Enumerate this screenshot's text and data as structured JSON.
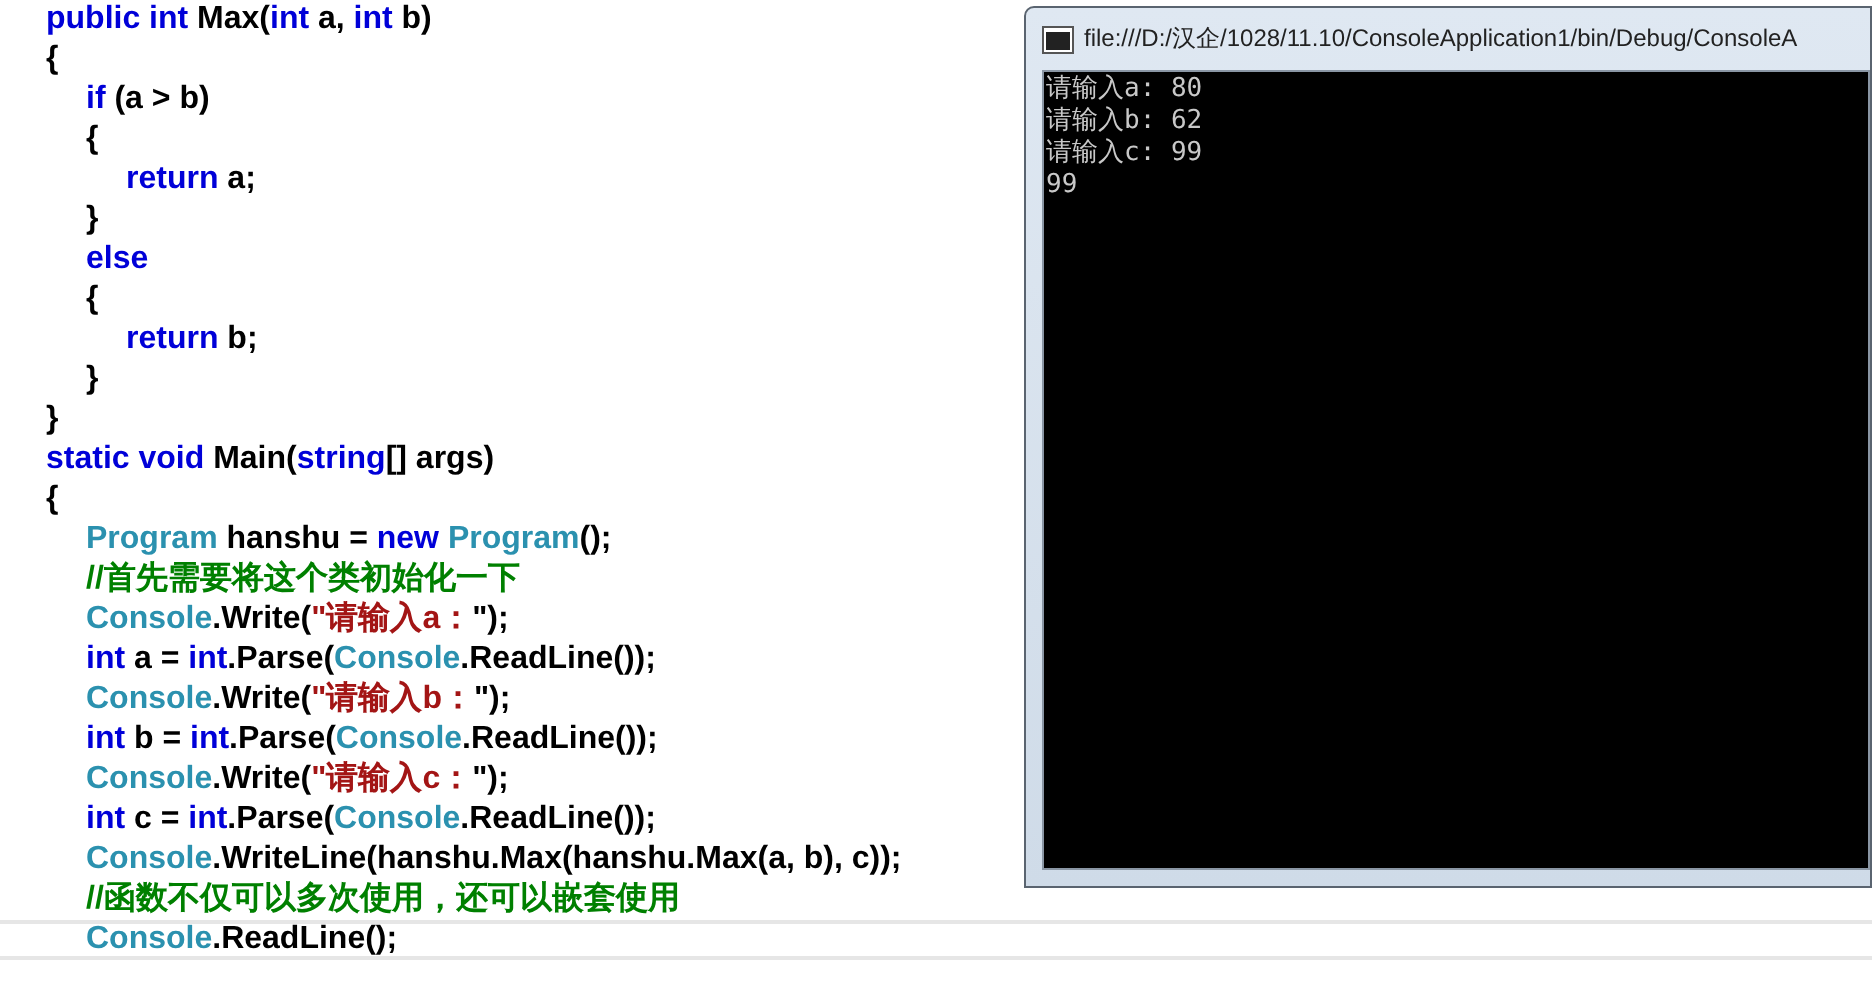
{
  "editor": {
    "lines": [
      {
        "current": false,
        "tokens": [
          {
            "kind": "keyword",
            "text": "public int "
          },
          {
            "kind": "plain",
            "text": "Max("
          },
          {
            "kind": "keyword",
            "text": "int"
          },
          {
            "kind": "plain",
            "text": " a, "
          },
          {
            "kind": "keyword",
            "text": "int"
          },
          {
            "kind": "plain",
            "text": " b)"
          }
        ]
      },
      {
        "current": false,
        "tokens": [
          {
            "kind": "plain",
            "text": "{"
          }
        ],
        "children": [
          {
            "current": false,
            "tokens": [
              {
                "kind": "keyword",
                "text": "if"
              },
              {
                "kind": "plain",
                "text": " (a > b)"
              }
            ]
          },
          {
            "current": false,
            "tokens": [
              {
                "kind": "plain",
                "text": "{"
              }
            ],
            "children": [
              {
                "current": false,
                "tokens": [
                  {
                    "kind": "keyword",
                    "text": "return"
                  },
                  {
                    "kind": "plain",
                    "text": " a;"
                  }
                ]
              }
            ]
          },
          {
            "current": false,
            "tokens": [
              {
                "kind": "plain",
                "text": "}"
              }
            ]
          },
          {
            "current": false,
            "tokens": [
              {
                "kind": "keyword",
                "text": "else"
              }
            ]
          },
          {
            "current": false,
            "tokens": [
              {
                "kind": "plain",
                "text": "{"
              }
            ],
            "children": [
              {
                "current": false,
                "tokens": [
                  {
                    "kind": "keyword",
                    "text": "return"
                  },
                  {
                    "kind": "plain",
                    "text": " b;"
                  }
                ]
              }
            ]
          },
          {
            "current": false,
            "tokens": [
              {
                "kind": "plain",
                "text": "}"
              }
            ]
          }
        ]
      },
      {
        "current": false,
        "tokens": [
          {
            "kind": "plain",
            "text": "}"
          }
        ]
      },
      {
        "current": false,
        "tokens": [
          {
            "kind": "keyword",
            "text": "static void "
          },
          {
            "kind": "plain",
            "text": "Main("
          },
          {
            "kind": "keyword",
            "text": "string"
          },
          {
            "kind": "plain",
            "text": "[] args)"
          }
        ]
      },
      {
        "current": false,
        "tokens": [
          {
            "kind": "plain",
            "text": "{"
          }
        ],
        "children": [
          {
            "current": false,
            "tokens": [
              {
                "kind": "type",
                "text": "Program"
              },
              {
                "kind": "plain",
                "text": " hanshu = "
              },
              {
                "kind": "keyword",
                "text": "new "
              },
              {
                "kind": "type",
                "text": "Program"
              },
              {
                "kind": "plain",
                "text": "();"
              }
            ]
          },
          {
            "current": false,
            "tokens": [
              {
                "kind": "comment",
                "text": "//首先需要将这个类初始化一下"
              }
            ]
          },
          {
            "current": false,
            "tokens": [
              {
                "kind": "type",
                "text": "Console"
              },
              {
                "kind": "plain",
                "text": ".Write("
              },
              {
                "kind": "string",
                "text": "\"请输入a："
              },
              {
                "kind": "plain",
                "text": "\");"
              }
            ]
          },
          {
            "current": false,
            "tokens": [
              {
                "kind": "keyword",
                "text": "int"
              },
              {
                "kind": "plain",
                "text": " a = "
              },
              {
                "kind": "keyword",
                "text": "int"
              },
              {
                "kind": "plain",
                "text": ".Parse("
              },
              {
                "kind": "type",
                "text": "Console"
              },
              {
                "kind": "plain",
                "text": ".ReadLine());"
              }
            ]
          },
          {
            "current": false,
            "tokens": [
              {
                "kind": "type",
                "text": "Console"
              },
              {
                "kind": "plain",
                "text": ".Write("
              },
              {
                "kind": "string",
                "text": "\"请输入b："
              },
              {
                "kind": "plain",
                "text": "\");"
              }
            ]
          },
          {
            "current": false,
            "tokens": [
              {
                "kind": "keyword",
                "text": "int"
              },
              {
                "kind": "plain",
                "text": " b = "
              },
              {
                "kind": "keyword",
                "text": "int"
              },
              {
                "kind": "plain",
                "text": ".Parse("
              },
              {
                "kind": "type",
                "text": "Console"
              },
              {
                "kind": "plain",
                "text": ".ReadLine());"
              }
            ]
          },
          {
            "current": false,
            "tokens": [
              {
                "kind": "type",
                "text": "Console"
              },
              {
                "kind": "plain",
                "text": ".Write("
              },
              {
                "kind": "string",
                "text": "\"请输入c："
              },
              {
                "kind": "plain",
                "text": "\");"
              }
            ]
          },
          {
            "current": false,
            "tokens": [
              {
                "kind": "keyword",
                "text": "int"
              },
              {
                "kind": "plain",
                "text": " c = "
              },
              {
                "kind": "keyword",
                "text": "int"
              },
              {
                "kind": "plain",
                "text": ".Parse("
              },
              {
                "kind": "type",
                "text": "Console"
              },
              {
                "kind": "plain",
                "text": ".ReadLine());"
              }
            ]
          },
          {
            "current": false,
            "tokens": [
              {
                "kind": "type",
                "text": "Console"
              },
              {
                "kind": "plain",
                "text": ".WriteLine(hanshu.Max(hanshu.Max(a, b), c));"
              }
            ]
          },
          {
            "current": false,
            "tokens": [
              {
                "kind": "comment",
                "text": "//函数不仅可以多次使用，还可以嵌套使用"
              }
            ]
          },
          {
            "current": true,
            "tokens": [
              {
                "kind": "type",
                "text": "Console"
              },
              {
                "kind": "plain",
                "text": ".ReadLine();"
              }
            ]
          }
        ]
      }
    ]
  },
  "console_window": {
    "title": "file:///D:/汉企/1028/11.10/ConsoleApplication1/bin/Debug/ConsoleA",
    "output": [
      "请输入a: 80",
      "请输入b: 62",
      "请输入c: 99",
      "99"
    ]
  }
}
